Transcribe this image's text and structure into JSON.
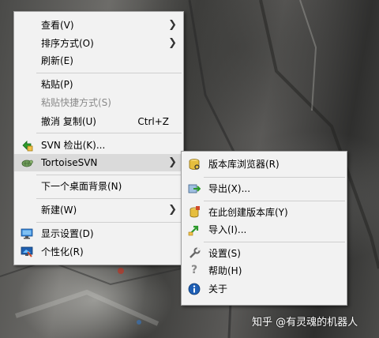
{
  "context_menu": {
    "items": [
      {
        "label": "查看(V)",
        "submenu": true
      },
      {
        "label": "排序方式(O)",
        "submenu": true
      },
      {
        "label": "刷新(E)"
      },
      {
        "label": "粘贴(P)"
      },
      {
        "label": "粘贴快捷方式(S)",
        "disabled": true
      },
      {
        "label": "撤消 复制(U)",
        "shortcut": "Ctrl+Z"
      },
      {
        "label": "SVN 检出(K)...",
        "icon": "svn-checkout-icon"
      },
      {
        "label": "TortoiseSVN",
        "icon": "tortoisesvn-icon",
        "submenu": true,
        "highlighted": true
      },
      {
        "label": "下一个桌面背景(N)"
      },
      {
        "label": "新建(W)",
        "submenu": true
      },
      {
        "label": "显示设置(D)",
        "icon": "display-settings-icon"
      },
      {
        "label": "个性化(R)",
        "icon": "personalize-icon"
      }
    ]
  },
  "tortoise_submenu": {
    "items": [
      {
        "label": "版本库浏览器(R)",
        "icon": "repo-browser-icon"
      },
      {
        "label": "导出(X)...",
        "icon": "export-icon"
      },
      {
        "label": "在此创建版本库(Y)",
        "icon": "create-repo-icon"
      },
      {
        "label": "导入(I)...",
        "icon": "import-icon"
      },
      {
        "label": "设置(S)",
        "icon": "settings-wrench-icon"
      },
      {
        "label": "帮助(H)",
        "icon": "help-icon"
      },
      {
        "label": "关于",
        "icon": "about-info-icon"
      }
    ]
  },
  "watermark": "知乎 @有灵魂的机器人",
  "colors": {
    "menu_bg": "#f2f2f2",
    "hover_bg": "#dadada",
    "disabled_text": "#8a8a8a"
  }
}
